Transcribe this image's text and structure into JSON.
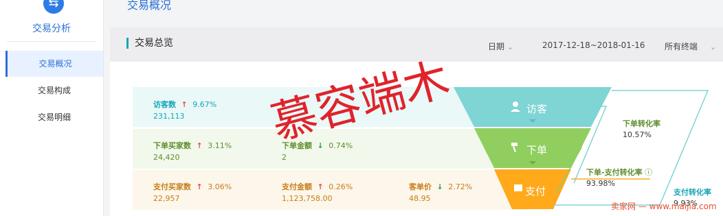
{
  "sidebar": {
    "logo_icon": "exchange-icon",
    "title": "交易分析",
    "items": [
      {
        "label": "交易概况",
        "active": true
      },
      {
        "label": "交易构成",
        "active": false
      },
      {
        "label": "交易明细",
        "active": false
      }
    ]
  },
  "header": {
    "title": "交易概况"
  },
  "filter_bar": {
    "section_title": "交易总览",
    "date_label": "日期",
    "date_range": "2017-12-18~2018-01-16",
    "terminal_label": "所有终端"
  },
  "metrics": {
    "visitors": {
      "label": "访客数",
      "direction": "up",
      "change": "9.67%",
      "value": "231,113"
    },
    "order_buyers": {
      "label": "下单买家数",
      "direction": "up",
      "change": "3.11%",
      "value": "24,420"
    },
    "order_amount": {
      "label": "下单金额",
      "direction": "down",
      "change": "0.74%",
      "value": "2"
    },
    "pay_buyers": {
      "label": "支付买家数",
      "direction": "up",
      "change": "3.06%",
      "value": "22,957"
    },
    "pay_amount": {
      "label": "支付金额",
      "direction": "up",
      "change": "0.26%",
      "value": "1,123,758.00"
    },
    "avg_order": {
      "label": "客单价",
      "direction": "down",
      "change": "2.72%",
      "value": "48.95"
    }
  },
  "funnel": {
    "stages": [
      {
        "label": "访客",
        "icon": "user-icon",
        "color": "#7fd4d4"
      },
      {
        "label": "下单",
        "icon": "hammer-icon",
        "color": "#90cf5f"
      },
      {
        "label": "支付",
        "icon": "wallet-icon",
        "color": "#ffa91b"
      }
    ],
    "rates": [
      {
        "label": "下单转化率",
        "value": "10.57%"
      },
      {
        "label": "下单-支付转化率",
        "value": "93.98%"
      },
      {
        "label": "支付转化率",
        "value": "9.93%"
      }
    ]
  },
  "watermark": {
    "text": "慕容端木"
  },
  "site_mark": {
    "text": "卖家网 — www.maijia.com"
  },
  "colors": {
    "up": "#e84b4b",
    "down": "#2e9a48",
    "teal": "#16a6b6",
    "green_text": "#5e8c2c",
    "orange_text": "#c57e19",
    "brand": "#2b6fd4"
  }
}
